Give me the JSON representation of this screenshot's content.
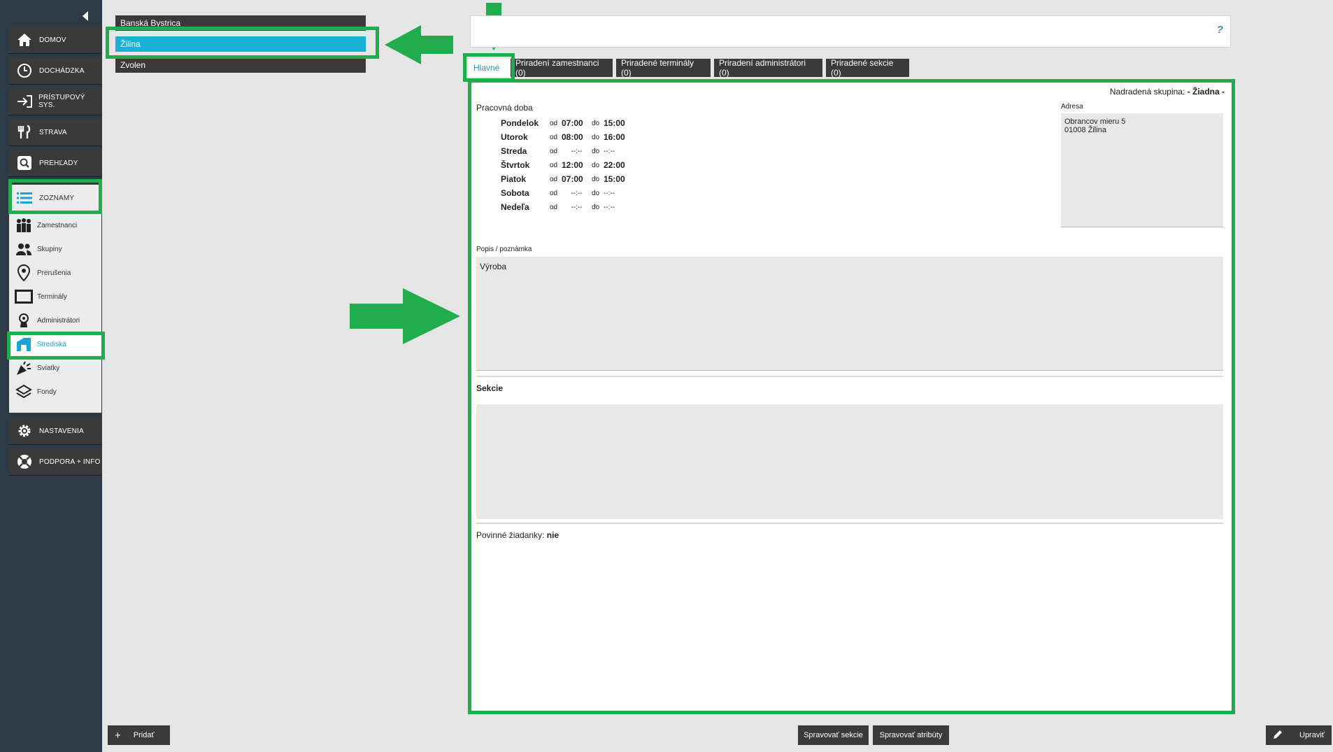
{
  "sidebar": {
    "main": [
      {
        "label": "DOMOV",
        "icon": "home-icon"
      },
      {
        "label": "DOCHÁDZKA",
        "icon": "clock-icon"
      },
      {
        "label": "PRÍSTUPOVÝ SYS.",
        "icon": "login-arrow-icon"
      },
      {
        "label": "STRAVA",
        "icon": "cutlery-icon"
      },
      {
        "label": "PREHĽADY",
        "icon": "search-icon"
      },
      {
        "label": "ZOZNAMY",
        "icon": "list-icon"
      }
    ],
    "sub": [
      {
        "label": "Zamestnanci",
        "icon": "employees-icon"
      },
      {
        "label": "Skupiny",
        "icon": "group-icon"
      },
      {
        "label": "Prerušenia",
        "icon": "map-pin-icon"
      },
      {
        "label": "Terminály",
        "icon": "terminal-icon"
      },
      {
        "label": "Administrátori",
        "icon": "admin-icon"
      },
      {
        "label": "Strediská",
        "icon": "building-icon"
      },
      {
        "label": "Sviatky",
        "icon": "party-icon"
      },
      {
        "label": "Fondy",
        "icon": "layers-icon"
      }
    ],
    "bottom": [
      {
        "label": "NASTAVENIA",
        "icon": "gear-icon"
      },
      {
        "label": "PODPORA + INFO",
        "icon": "lifebuoy-icon"
      }
    ]
  },
  "list": {
    "items": [
      "Banská Bystrica",
      "Žilina",
      "Zvolen"
    ]
  },
  "search": {
    "placeholder": "",
    "help": "?"
  },
  "tabs": [
    "Hlavné",
    "Priradení zamestnanci (0)",
    "Priradené terminály (0)",
    "Priradení administrátori (0)",
    "Priradené sekcie (0)"
  ],
  "detail": {
    "parent_label": "Nadradená skupina:",
    "parent_value": "- Žiadna -",
    "work_label": "Pracovná doba",
    "od": "od",
    "do": "do",
    "days": [
      {
        "day": "Pondelok",
        "from": "07:00",
        "to": "15:00"
      },
      {
        "day": "Utorok",
        "from": "08:00",
        "to": "16:00"
      },
      {
        "day": "Streda",
        "from": "--:--",
        "to": "--:--"
      },
      {
        "day": "Štvrtok",
        "from": "12:00",
        "to": "22:00"
      },
      {
        "day": "Piatok",
        "from": "07:00",
        "to": "15:00"
      },
      {
        "day": "Sobota",
        "from": "--:--",
        "to": "--:--"
      },
      {
        "day": "Nedeľa",
        "from": "--:--",
        "to": "--:--"
      }
    ],
    "address_label": "Adresa",
    "address_line1": "Obrancov mieru 5",
    "address_line2": "01008 Žilina",
    "note_label": "Popis / poznámka",
    "note_value": "Výroba",
    "sections_label": "Sekcie",
    "required_label": "Povinné žiadanky:",
    "required_value": "nie"
  },
  "buttons": {
    "add": "Pridať",
    "manage_sections": "Spravovať sekcie",
    "manage_attributes": "Spravovať atribúty",
    "edit": "Upraviť"
  },
  "colors": {
    "accent": "#19b1d6",
    "annotation": "#21ad4d",
    "dark": "#3a3a3a"
  }
}
